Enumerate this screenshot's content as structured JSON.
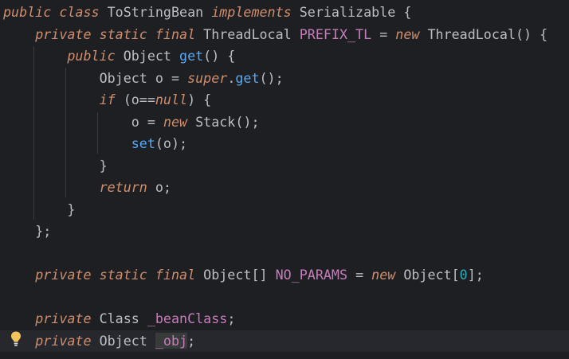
{
  "editor": {
    "language": "java",
    "colors": {
      "background": "#1e1f22",
      "current_line": "#26282e",
      "keyword": "#cf8e6d",
      "method": "#56a8f5",
      "constant_field": "#c77dbb",
      "number": "#2aacb8",
      "plain": "#bcbec4",
      "indent_guide": "#393b40",
      "caret": "#cdd0d6"
    },
    "lines": [
      "public class ToStringBean implements Serializable {",
      "    private static final ThreadLocal PREFIX_TL = new ThreadLocal() {",
      "        public Object get() {",
      "            Object o = super.get();",
      "            if (o==null) {",
      "                o = new Stack();",
      "                set(o);",
      "            }",
      "            return o;",
      "        }",
      "    };",
      "",
      "    private static final Object[] NO_PARAMS = new Object[0];",
      "",
      "    private Class _beanClass;",
      "    private Object _obj;"
    ],
    "tokens": {
      "l0": {
        "k1": "public",
        "k2": "class",
        "t1": "ToStringBean",
        "k3": "implements",
        "t2": "Serializable",
        "p1": "{"
      },
      "l1": {
        "k1": "private",
        "k2": "static",
        "k3": "final",
        "t1": "ThreadLocal",
        "f1": "PREFIX_TL",
        "p1": "=",
        "k4": "new",
        "t2": "ThreadLocal",
        "p2": "() {"
      },
      "l2": {
        "k1": "public",
        "t1": "Object",
        "m1": "get",
        "p1": "() {"
      },
      "l3": {
        "t1": "Object",
        "v1": "o",
        "p1": "=",
        "k1": "super",
        "p2": ".",
        "m1": "get",
        "p3": "();"
      },
      "l4": {
        "k1": "if",
        "p1": "(o==",
        "k2": "null",
        "p2": ") {"
      },
      "l5": {
        "v1": "o",
        "p1": "=",
        "k1": "new",
        "t1": "Stack",
        "p2": "();"
      },
      "l6": {
        "m1": "set",
        "p1": "(o);"
      },
      "l7": {
        "p1": "}"
      },
      "l8": {
        "k1": "return",
        "p1": "o;"
      },
      "l9": {
        "p1": "}"
      },
      "l10": {
        "p1": "};"
      },
      "l12": {
        "k1": "private",
        "k2": "static",
        "k3": "final",
        "t1": "Object[]",
        "f1": "NO_PARAMS",
        "p1": "=",
        "k4": "new",
        "t2": "Object[",
        "n1": "0",
        "p2": "];"
      },
      "l14": {
        "k1": "private",
        "t1": "Class",
        "f1": "_beanClass",
        "p1": ";"
      },
      "l15": {
        "k1": "private",
        "t1": "Object",
        "f1": "_obj",
        "p1": ";"
      }
    },
    "gutter": {
      "intention_icon": "lightbulb-icon",
      "intention_line": 16
    },
    "caret": {
      "line": 16,
      "before_token": "_obj"
    }
  }
}
